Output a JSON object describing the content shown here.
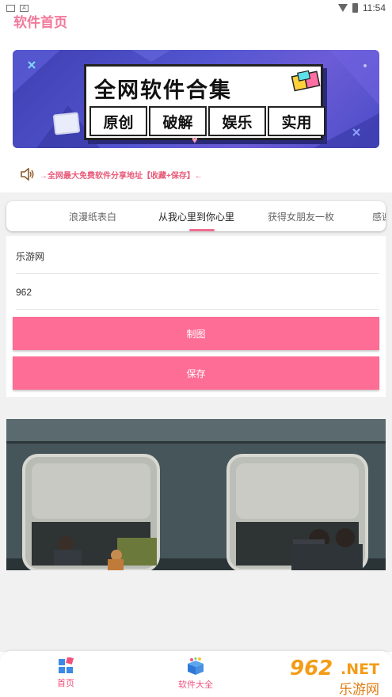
{
  "status_bar": {
    "time": "11:54",
    "notif_icons": [
      "notification-box-icon",
      "a-icon"
    ]
  },
  "header": {
    "title": "软件首页"
  },
  "banner": {
    "main_text": "全网软件合集",
    "sub_items": [
      "原创",
      "破解",
      "娱乐",
      "实用"
    ]
  },
  "notice": {
    "text": "→全网最大免费软件分享地址【收藏+保存】←",
    "icon": "speaker-icon"
  },
  "tabs": [
    {
      "label": "浪漫纸表白"
    },
    {
      "label": "从我心里到你心里",
      "active": true
    },
    {
      "label": "获得女朋友一枚"
    },
    {
      "label": "感谢"
    }
  ],
  "form": {
    "field1_value": "乐游网",
    "field2_value": "962",
    "make_button": "制图",
    "save_button": "保存"
  },
  "photo": {
    "description": "train-windows-image"
  },
  "bottom_nav": [
    {
      "label": "首页",
      "icon": "home-grid-icon"
    },
    {
      "label": "软件大全",
      "icon": "gift-box-icon"
    }
  ],
  "watermark": {
    "num": "962",
    "net": ".NET",
    "site": "乐游网"
  },
  "colors": {
    "accent": "#fd6d96",
    "title": "#f2789a",
    "banner_bg": "#4a4cc7"
  }
}
